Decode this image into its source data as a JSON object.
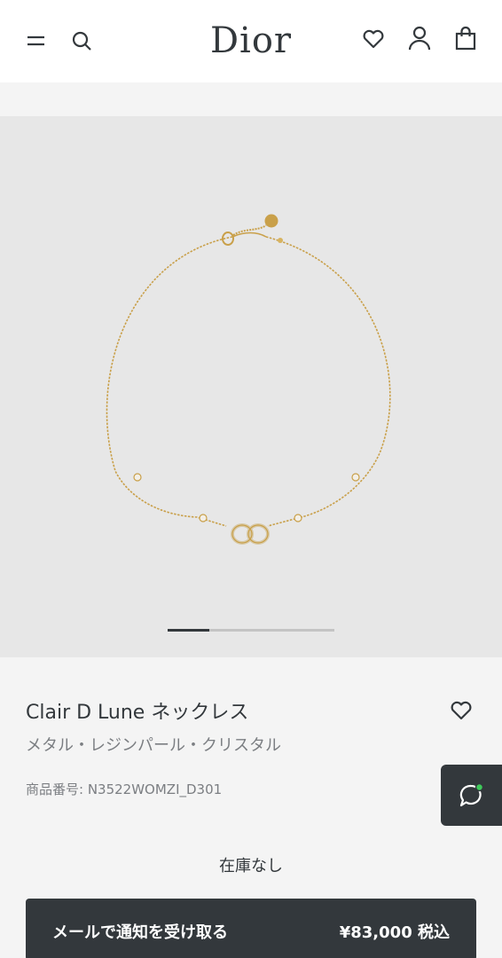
{
  "header": {
    "logo": "Dior",
    "icons": [
      "menu-icon",
      "search-icon",
      "heart-icon",
      "user-icon",
      "bag-icon"
    ]
  },
  "gallery": {
    "image_count": 4,
    "active_index": 1
  },
  "product": {
    "title": "Clair D Lune ネックレス",
    "subtitle": "メタル・レジンパール・クリスタル",
    "sku": "商品番号: N3522WOMZI_D301",
    "stock_status": "在庫なし"
  },
  "cta": {
    "label": "メールで通知を受け取る",
    "price": "¥83,000  税込"
  },
  "chat": {
    "icon": "chat-icon",
    "status_color": "#3ec95a"
  },
  "colors": {
    "dark": "#33383c",
    "gold": "#c9a04a",
    "gallery_bg": "#e7e7e7",
    "panel_bg": "#f4f4f4"
  }
}
